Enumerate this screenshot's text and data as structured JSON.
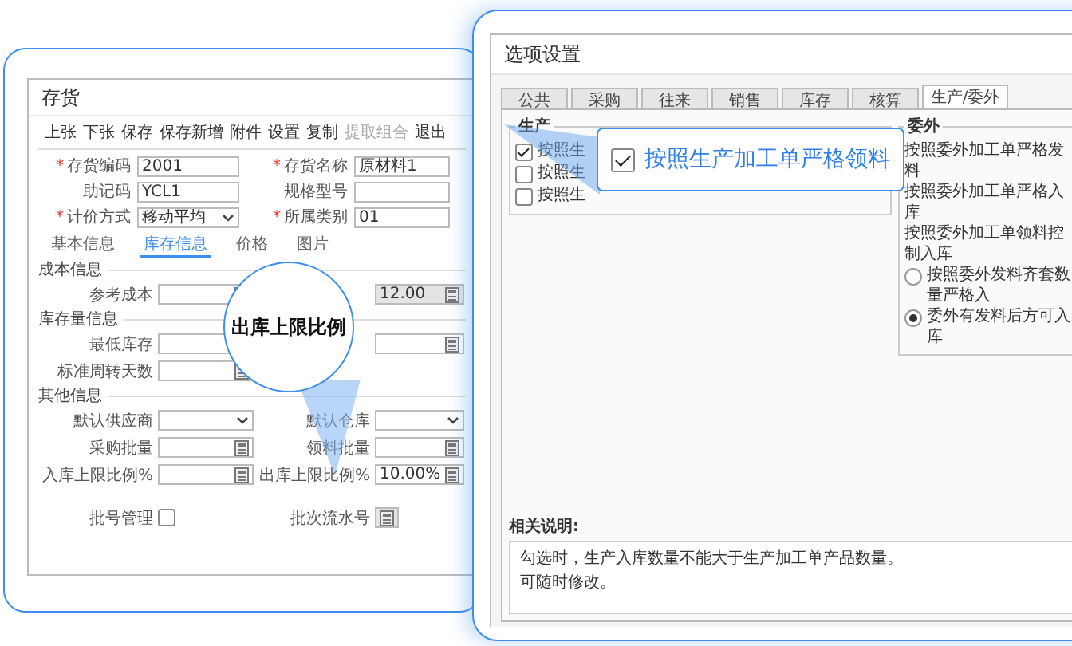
{
  "inventory_window": {
    "title": "存货",
    "toolbar": [
      {
        "label": "上张",
        "disabled": false
      },
      {
        "label": "下张",
        "disabled": false
      },
      {
        "label": "保存",
        "disabled": false
      },
      {
        "label": "保存新增",
        "disabled": false
      },
      {
        "label": "附件",
        "disabled": false
      },
      {
        "label": "设置",
        "disabled": false
      },
      {
        "label": "复制",
        "disabled": false
      },
      {
        "label": "提取组合",
        "disabled": true
      },
      {
        "label": "退出",
        "disabled": false
      }
    ],
    "fields": [
      {
        "label": "存货编码",
        "required": true,
        "kind": "text",
        "value": "2001"
      },
      {
        "label": "存货名称",
        "required": true,
        "kind": "text",
        "value": "原材料1"
      },
      {
        "label": "助记码",
        "required": false,
        "kind": "text",
        "value": "YCL1"
      },
      {
        "label": "规格型号",
        "required": false,
        "kind": "text"
      },
      {
        "label": "计价方式",
        "required": true,
        "kind": "select",
        "value": "移动平均"
      },
      {
        "label": "所属类别",
        "required": true,
        "kind": "text",
        "value": "01"
      }
    ],
    "tabs": [
      {
        "label": "基本信息",
        "selected": false
      },
      {
        "label": "库存信息",
        "selected": true
      },
      {
        "label": "价格",
        "selected": false
      },
      {
        "label": "图片",
        "selected": false
      }
    ],
    "sections": [
      {
        "title": "成本信息",
        "rows": [
          [
            {
              "label": "参考成本",
              "kind": "number",
              "disabled": false
            },
            {
              "kind": "number",
              "disabled": true,
              "value": "12.00"
            }
          ]
        ]
      },
      {
        "title": "库存量信息",
        "rows": [
          [
            {
              "label": "最低库存",
              "kind": "number",
              "disabled": false
            },
            {
              "kind": "number",
              "disabled": false
            }
          ],
          [
            {
              "label": "标准周转天数",
              "kind": "number",
              "disabled": false
            }
          ]
        ]
      },
      {
        "title": "其他信息",
        "rows": [
          [
            {
              "label": "默认供应商",
              "kind": "select",
              "disabled": false
            },
            {
              "label": "默认仓库",
              "kind": "select",
              "disabled": false
            }
          ],
          [
            {
              "label": "采购批量",
              "kind": "number",
              "disabled": false
            },
            {
              "label": "领料批量",
              "kind": "number",
              "disabled": false
            }
          ],
          [
            {
              "label": "入库上限比例%",
              "kind": "number",
              "disabled": false
            },
            {
              "label": "出库上限比例%",
              "kind": "number",
              "disabled": false,
              "value": "10.00%"
            }
          ]
        ]
      }
    ],
    "footer_row": [
      {
        "label": "批号管理",
        "kind": "checkbox",
        "checked": false
      },
      {
        "label": "批次流水号",
        "kind": "number",
        "disabled": true
      }
    ],
    "callout": "出库上限比例",
    "required_mark": "*"
  },
  "options_window": {
    "title": "选项设置",
    "tabs": [
      {
        "label": "公共",
        "selected": false
      },
      {
        "label": "采购",
        "selected": false
      },
      {
        "label": "往来",
        "selected": false
      },
      {
        "label": "销售",
        "selected": false
      },
      {
        "label": "库存",
        "selected": false
      },
      {
        "label": "核算",
        "selected": false
      },
      {
        "label": "生产/委外",
        "selected": true
      }
    ],
    "production_group": {
      "title": "生产",
      "items": [
        {
          "label": "按照生",
          "checked": true
        },
        {
          "label": "按照生",
          "checked": false
        },
        {
          "label": "按照生",
          "checked": false
        }
      ]
    },
    "outsourcing_group": {
      "title": "委外",
      "items": [
        {
          "kind": "plain",
          "label": "按照委外加工单严格发料"
        },
        {
          "kind": "plain",
          "label": "按照委外加工单严格入库"
        },
        {
          "kind": "plain",
          "label": "按照委外加工单领料控制入库"
        },
        {
          "kind": "radio",
          "label": "按照委外发料齐套数量严格入",
          "selected": false
        },
        {
          "kind": "radio",
          "label": "委外有发料后方可入库",
          "selected": true
        }
      ]
    },
    "notes_title": "相关说明:",
    "notes": [
      "勾选时，生产入库数量不能大于生产加工单产品数量。",
      "可随时修改。"
    ],
    "callout": {
      "label": "按照生产加工单严格领料",
      "checked": true
    }
  }
}
